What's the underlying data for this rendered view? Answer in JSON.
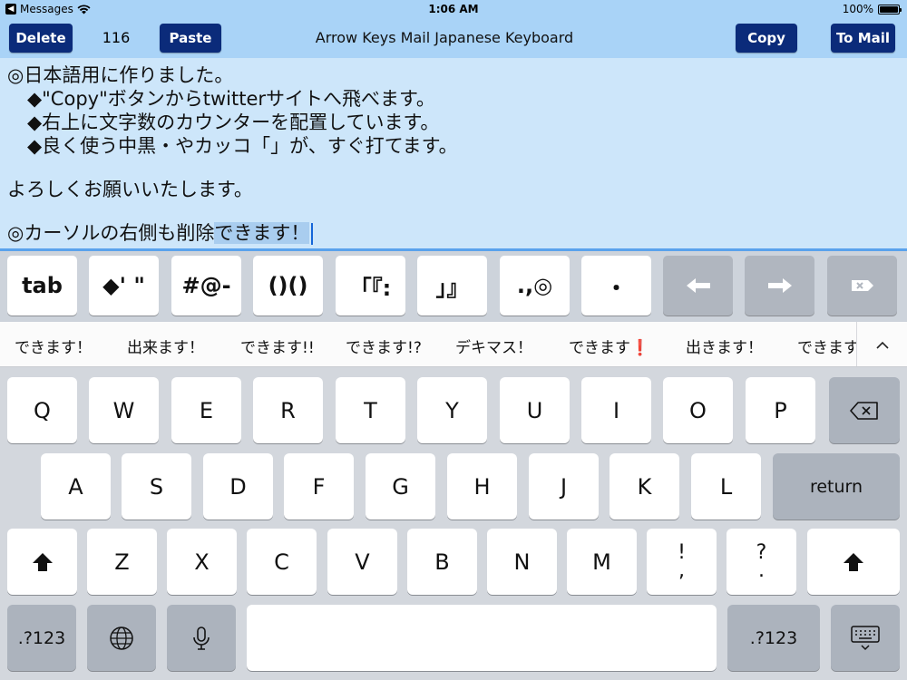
{
  "status_bar": {
    "back_app": "Messages",
    "time": "1:06 AM",
    "battery": "100%"
  },
  "toolbar": {
    "delete_label": "Delete",
    "count": "116",
    "paste_label": "Paste",
    "title": "Arrow Keys Mail Japanese Keyboard",
    "copy_label": "Copy",
    "to_mail_label": "To Mail"
  },
  "editor": {
    "line1": "◎日本語用に作りました。",
    "line2": "◆\"Copy\"ボタンからtwitterサイトへ飛べます。",
    "line3": "◆右上に文字数のカウンターを配置しています。",
    "line4": "◆良く使う中黒・やカッコ「」が、すぐ打てます。",
    "line5": "よろしくお願いいたします。",
    "line6_prefix": "◎カーソルの右側も削除",
    "line6_marked": "できます！"
  },
  "custom_keys": {
    "tab": "tab",
    "diamond_quotes": "◆' \"",
    "symbols": "#@-",
    "parens": "()()",
    "brackets": "「『:",
    "close_brackets": "」』",
    "punct": ".,◎",
    "nakaguro": "・"
  },
  "suggestions": [
    "できます！",
    "出来ます！",
    "できます!!",
    "できます!?",
    "デキマス！",
    "できます",
    "出きます！",
    "できます"
  ],
  "suggestion_emoji_mark": "❗",
  "keyboard": {
    "row1": [
      "Q",
      "W",
      "E",
      "R",
      "T",
      "Y",
      "U",
      "I",
      "O",
      "P"
    ],
    "row2": [
      "A",
      "S",
      "D",
      "F",
      "G",
      "H",
      "J",
      "K",
      "L"
    ],
    "row3": [
      "Z",
      "X",
      "C",
      "V",
      "B",
      "N",
      "M"
    ],
    "punct1_top": "!",
    "punct1_bottom": ",",
    "punct2_top": "?",
    "punct2_bottom": ".",
    "return_label": "return",
    "num_label": ".?123"
  },
  "colors": {
    "accent_button": "#0b2b7a",
    "toolbar_bg": "#a9d3f7",
    "editor_bg": "#cde6fa"
  }
}
